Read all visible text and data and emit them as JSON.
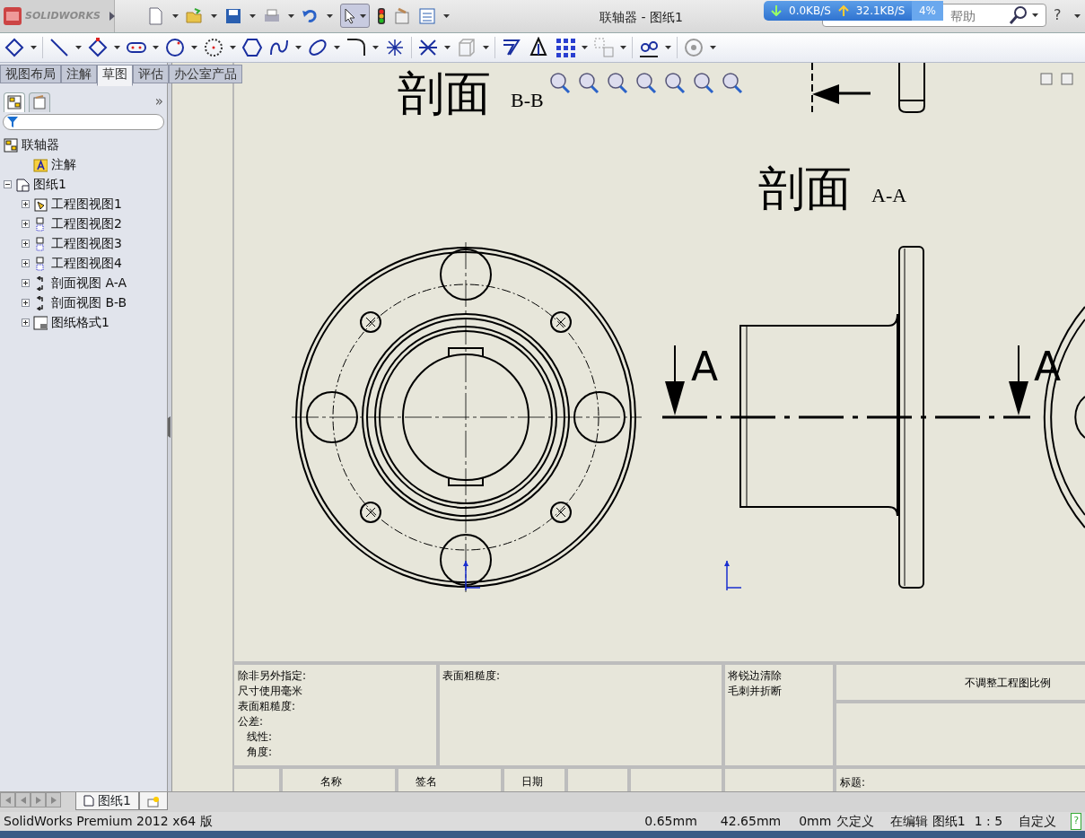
{
  "app": {
    "logo": "SOLIDWORKS",
    "document_title": "联轴器 - 图纸1",
    "search": {
      "placeholder": "帮助"
    },
    "help": "?"
  },
  "net_monitor": {
    "down": "0.0KB/S",
    "up": "32.1KB/S",
    "load": "4%"
  },
  "tabs": [
    {
      "label": "视图布局",
      "selected": false
    },
    {
      "label": "注解",
      "selected": false
    },
    {
      "label": "草图",
      "selected": true
    },
    {
      "label": "评估",
      "selected": false
    },
    {
      "label": "办公室产品",
      "selected": false
    }
  ],
  "tree": {
    "collapse": "»",
    "root": {
      "label": "联轴器",
      "kind": "assembly"
    },
    "items": [
      {
        "label": "注解",
        "kind": "annotation"
      },
      {
        "label": "图纸1",
        "kind": "sheet",
        "expanded": true,
        "children": [
          {
            "label": "工程图视图1",
            "kind": "model-view",
            "expanded": false
          },
          {
            "label": "工程图视图2",
            "kind": "view",
            "expanded": false
          },
          {
            "label": "工程图视图3",
            "kind": "view",
            "expanded": false
          },
          {
            "label": "工程图视图4",
            "kind": "view",
            "expanded": false
          },
          {
            "label": "剖面视图 A-A",
            "kind": "section",
            "expanded": false
          },
          {
            "label": "剖面视图 B-B",
            "kind": "section",
            "expanded": false
          },
          {
            "label": "图纸格式1",
            "kind": "format",
            "expanded": false
          }
        ]
      }
    ]
  },
  "drawing": {
    "section_titles": [
      {
        "word": "剖面",
        "label": "B-B"
      },
      {
        "word": "剖面",
        "label": "A-A"
      }
    ],
    "cut_labels": [
      "A",
      "A"
    ]
  },
  "title_block": {
    "notes": [
      "除非另外指定:",
      "尺寸使用毫米",
      "表面粗糙度:",
      "公差:"
    ],
    "tolerances": [
      "线性:",
      "角度:"
    ],
    "surface": "表面粗糙度:",
    "deburr": [
      "将锐边清除",
      "毛刺并折断"
    ],
    "scale_note": "不调整工程图比例",
    "headers": [
      "名称",
      "签名",
      "日期"
    ],
    "title_label": "标题:"
  },
  "sheet_tabs": [
    {
      "label": "图纸1",
      "selected": true
    }
  ],
  "status_bar": {
    "product": "SolidWorks Premium 2012 x64 版",
    "x": "0.65mm",
    "y": "42.65mm",
    "z": "0mm",
    "state": "欠定义",
    "mode": "在编辑 图纸1",
    "scale": "1 : 5",
    "units": "自定义",
    "help": "?"
  }
}
